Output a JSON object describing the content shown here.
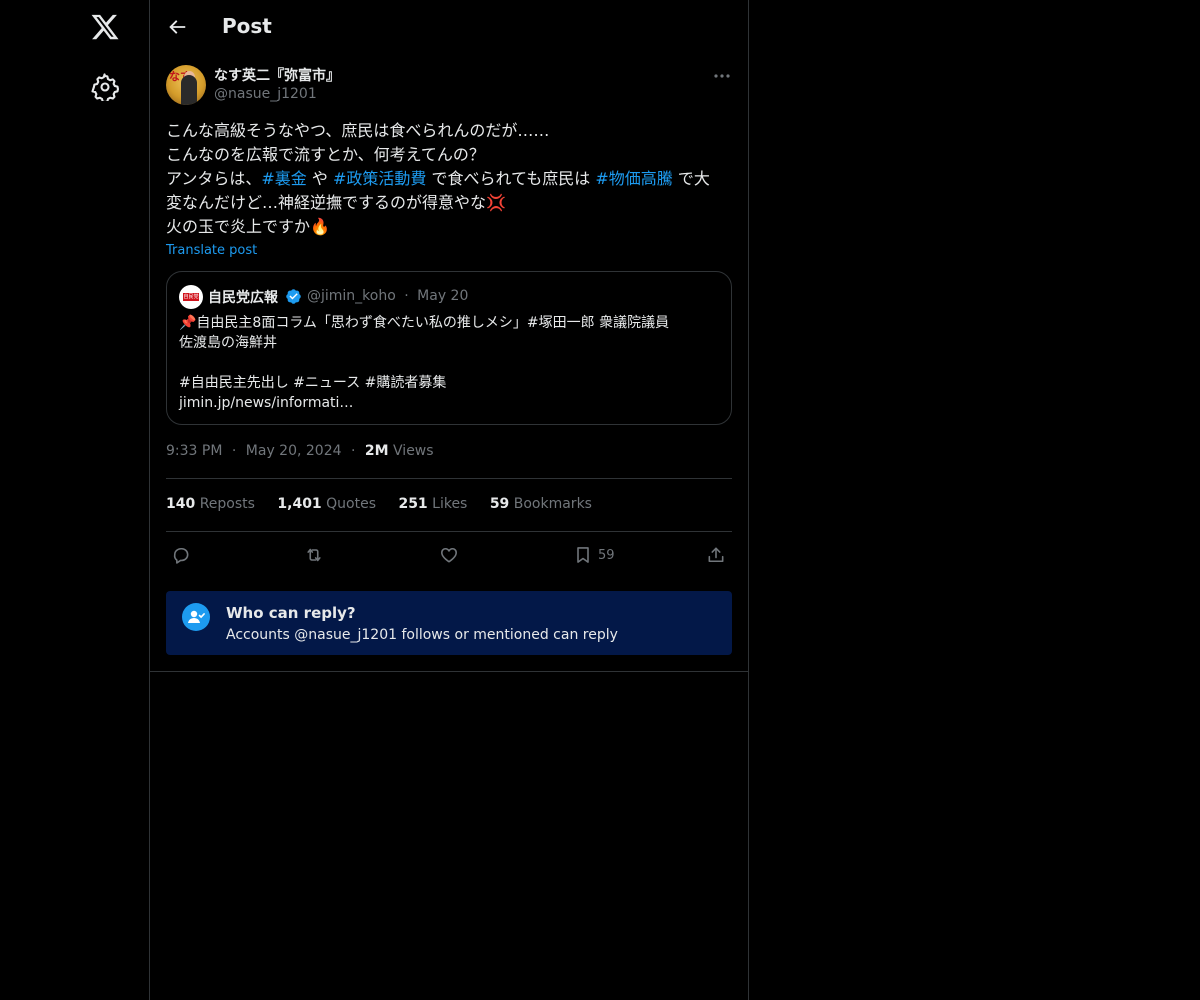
{
  "header": {
    "title": "Post"
  },
  "author": {
    "name": "なす英二『弥富市』",
    "handle": "@nasue_j1201",
    "avatar_text": "なす"
  },
  "tweet": {
    "lines": [
      [
        {
          "t": "こんな高級そうなやつ、庶民は食べられんのだが……"
        }
      ],
      [
        {
          "t": "こんなのを広報で流すとか、何考えてんの？"
        }
      ],
      [
        {
          "t": "アンタらは、"
        },
        {
          "t": "#裏金",
          "tag": true
        },
        {
          "t": " や "
        },
        {
          "t": "#政策活動費",
          "tag": true
        },
        {
          "t": " で食べられても庶民は "
        },
        {
          "t": "#物価高騰",
          "tag": true
        },
        {
          "t": " で大"
        }
      ],
      [
        {
          "t": "変なんだけど…神経逆撫でするのが得意やな💢"
        }
      ],
      [
        {
          "t": "火の玉で炎上ですか🔥"
        }
      ]
    ],
    "translate_label": "Translate post"
  },
  "quote": {
    "name": "自民党広報",
    "handle": "@jimin_koho",
    "separator": "·",
    "date": "May 20",
    "avatar_text": "自民党",
    "lines": [
      "📌自由民主8面コラム「思わず食べたい私の推しメシ」#塚田一郎 衆議院議員",
      "佐渡島の海鮮丼",
      "",
      "#自由民主先出し #ニュース #購読者募集",
      "jimin.jp/news/informati…"
    ]
  },
  "meta": {
    "time": "9:33 PM",
    "separator": "·",
    "date": "May 20, 2024",
    "views_count": "2M",
    "views_label": "Views"
  },
  "stats": {
    "reposts_count": "140",
    "reposts_label": "Reposts",
    "quotes_count": "1,401",
    "quotes_label": "Quotes",
    "likes_count": "251",
    "likes_label": "Likes",
    "bookmarks_count": "59",
    "bookmarks_label": "Bookmarks"
  },
  "actions": {
    "bookmark_count": "59"
  },
  "reply_restriction": {
    "title": "Who can reply?",
    "subtitle": "Accounts @nasue_j1201 follows or mentioned can reply"
  },
  "colors": {
    "accent": "#1d9bf0",
    "muted": "#71767b",
    "reply_box_bg": "#031848"
  },
  "icons": [
    "x-logo-icon",
    "settings-icon",
    "back-arrow-icon",
    "more-icon",
    "verified-icon",
    "reply-icon",
    "repost-icon",
    "like-icon",
    "bookmark-icon",
    "share-icon",
    "mention-user-icon"
  ]
}
